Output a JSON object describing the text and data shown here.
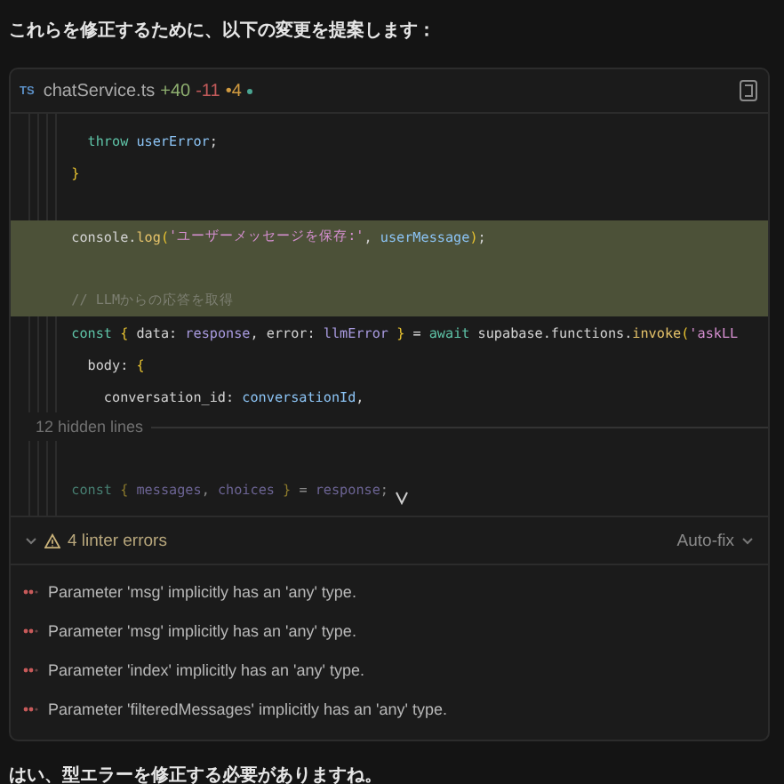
{
  "intro": "これらを修正するために、以下の変更を提案します：",
  "file": {
    "badge": "TS",
    "name": "chatService.ts",
    "added": "+40",
    "removed": "-11",
    "modified": "•4"
  },
  "code_before": [
    {
      "kind": "code",
      "highlighted": false,
      "tokens": [
        {
          "text": "    throw ",
          "color": "#5fc4a8"
        },
        {
          "text": "userError",
          "color": "#8cc4f5"
        },
        {
          "text": ";",
          "color": "#d4d4d4"
        }
      ]
    },
    {
      "kind": "code",
      "highlighted": false,
      "tokens": [
        {
          "text": "  }",
          "color": "#e8c330"
        }
      ]
    },
    {
      "kind": "blank",
      "highlighted": false
    },
    {
      "kind": "code",
      "highlighted": true,
      "tokens": [
        {
          "text": "  console.",
          "color": "#d4d4d4"
        },
        {
          "text": "log",
          "color": "#e6c36a"
        },
        {
          "text": "(",
          "color": "#e8c330"
        },
        {
          "text": "'ユーザーメッセージを保存:'",
          "color": "#d58fd0"
        },
        {
          "text": ", ",
          "color": "#d4d4d4"
        },
        {
          "text": "userMessage",
          "color": "#8cc4f5"
        },
        {
          "text": ")",
          "color": "#e8c330"
        },
        {
          "text": ";",
          "color": "#d4d4d4"
        }
      ]
    },
    {
      "kind": "blank",
      "highlighted": true
    },
    {
      "kind": "code",
      "highlighted": true,
      "tokens": [
        {
          "text": "  // LLMからの応答を取得",
          "color": "#7d7f72"
        }
      ]
    },
    {
      "kind": "code",
      "highlighted": false,
      "tokens": [
        {
          "text": "  const ",
          "color": "#5fc4a8"
        },
        {
          "text": "{",
          "color": "#e8c330"
        },
        {
          "text": " data: ",
          "color": "#d4d4d4"
        },
        {
          "text": "response",
          "color": "#a99be0"
        },
        {
          "text": ", error: ",
          "color": "#d4d4d4"
        },
        {
          "text": "llmError ",
          "color": "#a99be0"
        },
        {
          "text": "}",
          "color": "#e8c330"
        },
        {
          "text": " = ",
          "color": "#d4d4d4"
        },
        {
          "text": "await",
          "color": "#5fc4a8"
        },
        {
          "text": " supabase.functions.",
          "color": "#d4d4d4"
        },
        {
          "text": "invoke",
          "color": "#e6c36a"
        },
        {
          "text": "(",
          "color": "#e8c330"
        },
        {
          "text": "'askLL",
          "color": "#d58fd0"
        }
      ]
    },
    {
      "kind": "code",
      "highlighted": false,
      "tokens": [
        {
          "text": "    body: ",
          "color": "#d4d4d4"
        },
        {
          "text": "{",
          "color": "#e8c330"
        }
      ]
    },
    {
      "kind": "code",
      "highlighted": false,
      "tokens": [
        {
          "text": "      conversation_id: ",
          "color": "#d4d4d4"
        },
        {
          "text": "conversationId",
          "color": "#8cc4f5"
        },
        {
          "text": ",",
          "color": "#d4d4d4"
        }
      ]
    }
  ],
  "hidden_lines": "12 hidden lines",
  "code_after": [
    {
      "kind": "blank",
      "highlighted": false
    },
    {
      "kind": "code",
      "highlighted": false,
      "tokens": [
        {
          "text": "  const ",
          "color": "#477f72"
        },
        {
          "text": "{ ",
          "color": "#8c7a2c"
        },
        {
          "text": "messages",
          "color": "#6c6494"
        },
        {
          "text": ", ",
          "color": "#888888"
        },
        {
          "text": "choices ",
          "color": "#6c6494"
        },
        {
          "text": "}",
          "color": "#8c7a2c"
        },
        {
          "text": " = ",
          "color": "#888888"
        },
        {
          "text": "response",
          "color": "#6c6494"
        },
        {
          "text": ";",
          "color": "#888888"
        }
      ]
    }
  ],
  "linter": {
    "expanded": true,
    "title": "4 linter errors",
    "action": "Auto-fix",
    "errors": [
      "Parameter 'msg' implicitly has an 'any' type.",
      "Parameter 'msg' implicitly has an 'any' type.",
      "Parameter 'index' implicitly has an 'any' type.",
      "Parameter 'filteredMessages' implicitly has an 'any' type."
    ]
  },
  "reply": "はい、型エラーを修正する必要がありますね。"
}
